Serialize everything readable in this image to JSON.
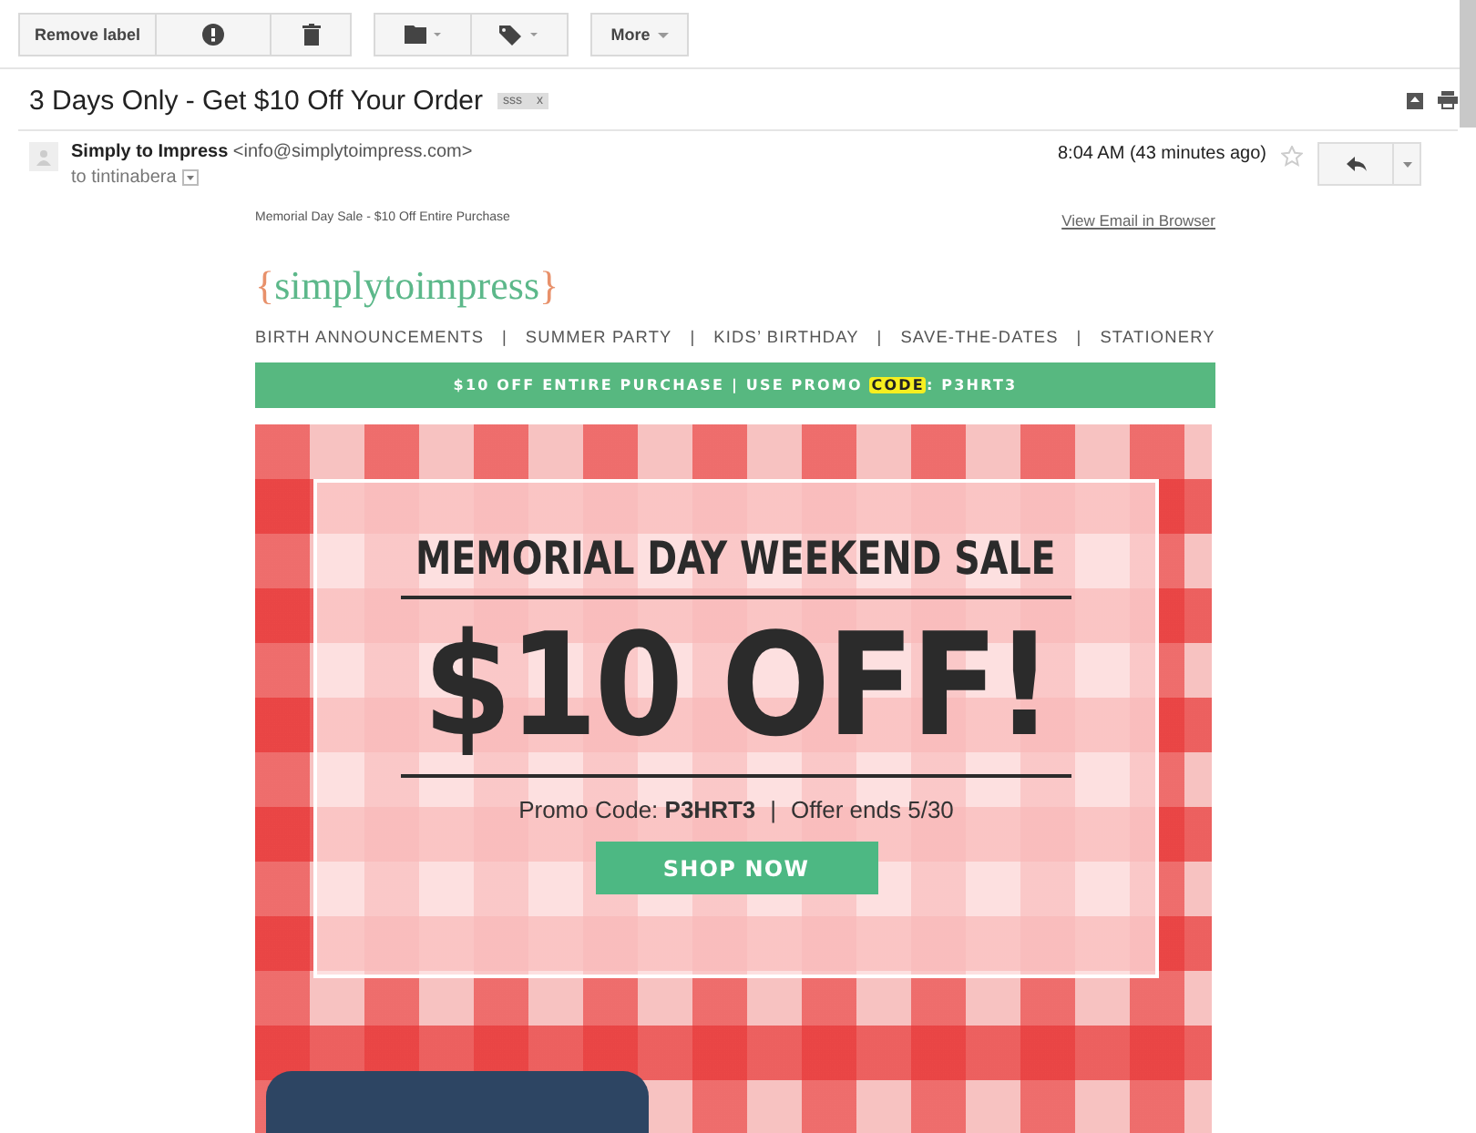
{
  "toolbar": {
    "buttons": [
      {
        "kind": "text",
        "label": "Remove label"
      },
      {
        "kind": "report"
      },
      {
        "kind": "delete"
      },
      {
        "kind": "folder"
      },
      {
        "kind": "tag"
      },
      {
        "kind": "more",
        "label": "More"
      }
    ]
  },
  "subject": {
    "title": "3 Days Only - Get $10 Off Your Order",
    "label": "sss",
    "label_close": "x"
  },
  "message": {
    "sender_name": "Simply to Impress",
    "sender_email": "<info@simplytoimpress.com>",
    "to": "to tintinabera",
    "time": "8:04 AM (43 minutes ago)",
    "starred": false
  },
  "email": {
    "preheader": "Memorial Day Sale - $10 Off Entire Purchase",
    "view_link": "View Email in Browser",
    "logo": {
      "open": "{",
      "name": "simplytoimpress",
      "close": "}"
    },
    "nav": [
      "BIRTH ANNOUNCEMENTS",
      "SUMMER PARTY",
      "KIDS’ BIRTHDAY",
      "SAVE-THE-DATES",
      "STATIONERY"
    ],
    "nav_separator": "|",
    "promo_bar": {
      "before": "$10 OFF ENTIRE PURCHASE | USE PROMO ",
      "highlight": "CODE",
      "after": ": P3HRT3"
    },
    "hero": {
      "heading": "MEMORIAL DAY WEEKEND SALE",
      "offer": "$10 OFF!",
      "promo_label": "Promo Code: ",
      "promo_code": "P3HRT3",
      "offer_end": "Offer ends 5/30",
      "button": "SHOP NOW"
    }
  }
}
